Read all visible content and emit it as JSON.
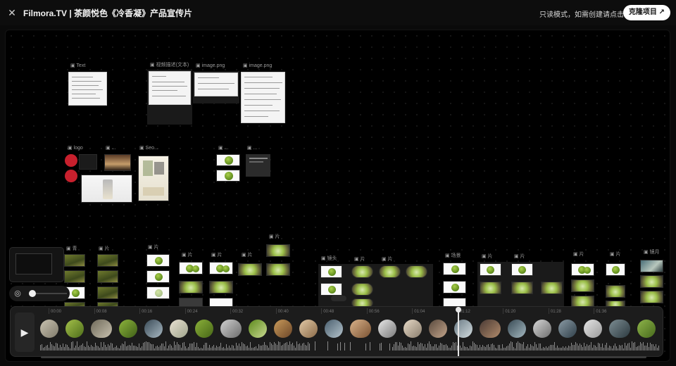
{
  "topbar": {
    "title": "Filmora.TV | 茶颜悦色《冷香凝》产品宣传片",
    "readonly_hint": "只读模式，如需创建请点击",
    "clone_button": "克隆项目 ↗",
    "close_icon": "close-icon"
  },
  "canvas": {
    "groups": [
      {
        "label": "▣ Text"
      },
      {
        "label": "▣ 视频描述(文本)"
      },
      {
        "label": "▣ image.png"
      },
      {
        "label": "▣ image.png"
      },
      {
        "label": "▣ logo"
      },
      {
        "label": "▣ ..."
      },
      {
        "label": "▣ Seo..."
      },
      {
        "label": "▣ ..."
      },
      {
        "label": "▣ ..."
      }
    ],
    "row_labels": [
      "▣ 青",
      "▣ 片",
      "▣ 片",
      "▣ 片",
      "▣ 片",
      "▣ 片",
      "▣ 片",
      "▣ 片",
      "▣ 镜头",
      "▣ 片",
      "▣ 片",
      "▣ 场景",
      "▣ 片",
      "▣ 片",
      "▣ 片",
      "▣ 片",
      "▣ 片",
      "▣ 镜月"
    ]
  },
  "timeline": {
    "play_icon": "play-icon",
    "ticks": [
      "00:00",
      "00:08",
      "00:16",
      "00:24",
      "00:32",
      "00:40",
      "00:48",
      "00:56",
      "01:04",
      "01:12",
      "01:20",
      "01:28",
      "01:36"
    ],
    "playhead_fraction": 0.69
  },
  "colors": {
    "clone_button_bg": "#ffffff",
    "board_bg": "#000000",
    "timeline_bg": "#1c1c1c"
  }
}
